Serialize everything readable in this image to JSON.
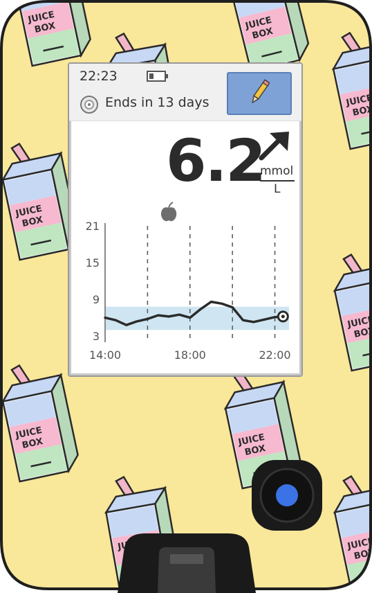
{
  "status": {
    "time": "22:23",
    "sensor_text": "Ends in 13 days"
  },
  "reading": {
    "value": "6.2",
    "unit_top": "mmol",
    "unit_bottom": "L",
    "trend": "rising"
  },
  "icons": {
    "battery": "battery-icon",
    "sensor": "sensor-icon",
    "edit": "pencil-icon",
    "trend": "arrow-up-right-icon",
    "food_note": "apple-icon",
    "label_text": "JUICE BOX"
  },
  "colors": {
    "background": "#f9e79a",
    "target_band": "#cfe6f2",
    "edit_button": "#7ea2d6",
    "home_button_dot": "#3b73e6"
  },
  "chart_data": {
    "type": "line",
    "x_labels": [
      "14:00",
      "18:00",
      "22:00"
    ],
    "y_ticks": [
      3,
      9,
      15,
      21
    ],
    "xlim": [
      "14:00",
      "22:40"
    ],
    "ylim": [
      2,
      21
    ],
    "target_range": [
      4.0,
      7.8
    ],
    "marker_times": [
      "16:00",
      "20:00"
    ],
    "food_note_time": "17:00",
    "series": [
      {
        "x": [
          "14:00",
          "14:30",
          "15:00",
          "15:30",
          "16:00",
          "16:30",
          "17:00",
          "17:30",
          "18:00",
          "18:30",
          "19:00",
          "19:30",
          "20:00",
          "20:30",
          "21:00",
          "21:30",
          "22:00",
          "22:23"
        ],
        "values": [
          6.0,
          5.6,
          4.8,
          5.4,
          5.8,
          6.4,
          6.2,
          6.5,
          6.0,
          7.4,
          8.6,
          8.3,
          7.7,
          5.6,
          5.3,
          5.7,
          6.1,
          6.2
        ]
      }
    ]
  }
}
